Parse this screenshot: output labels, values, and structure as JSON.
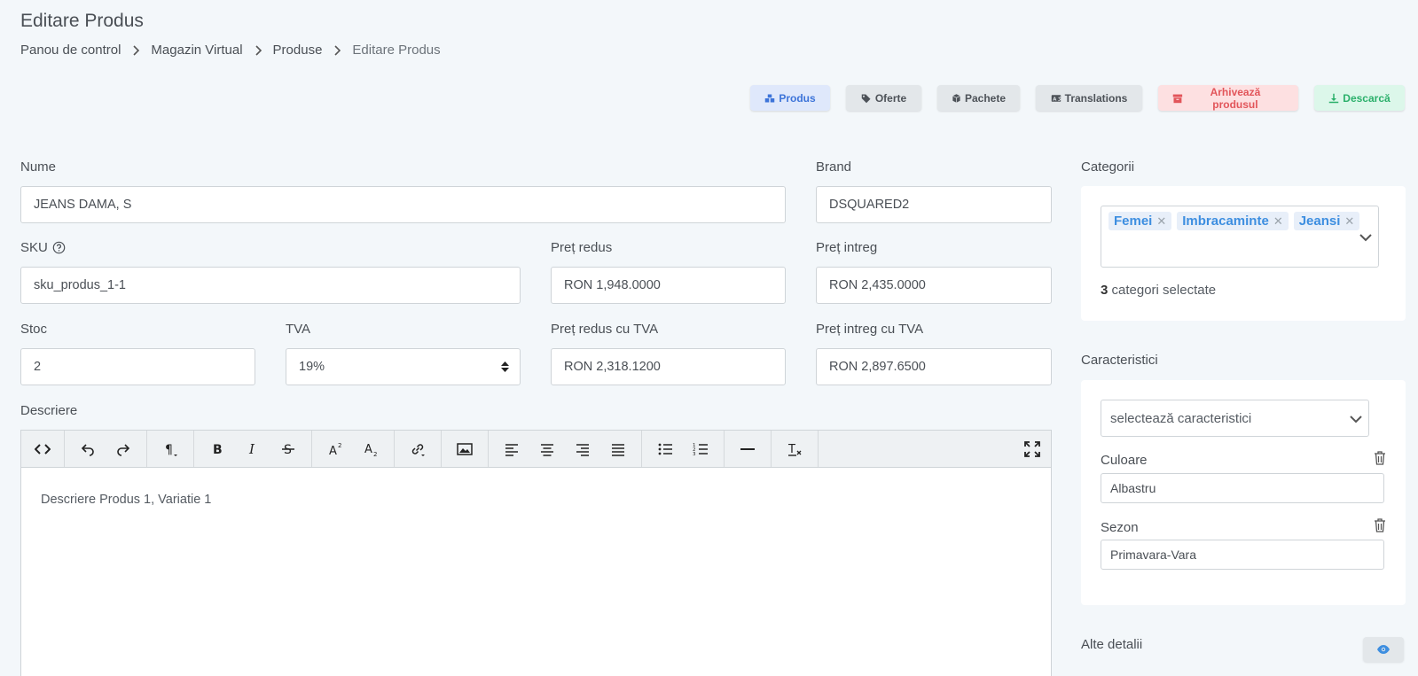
{
  "page": {
    "title": "Editare Produs"
  },
  "breadcrumb": [
    "Panou de control",
    "Magazin Virtual",
    "Produse",
    "Editare Produs"
  ],
  "actions": {
    "produs": "Produs",
    "oferte": "Oferte",
    "pachete": "Pachete",
    "translations": "Translations",
    "arhiveaza": "Arhivează produsul",
    "descarca": "Descarcă"
  },
  "form": {
    "nume": {
      "label": "Nume",
      "value": "JEANS DAMA, S"
    },
    "brand": {
      "label": "Brand",
      "value": "DSQUARED2"
    },
    "sku": {
      "label": "SKU",
      "value": "sku_produs_1-1"
    },
    "pret_redus": {
      "label": "Preț redus",
      "value": "RON 1,948.0000"
    },
    "pret_intreg": {
      "label": "Preț intreg",
      "value": "RON 2,435.0000"
    },
    "stoc": {
      "label": "Stoc",
      "value": "2"
    },
    "tva": {
      "label": "TVA",
      "value": "19%"
    },
    "pret_redus_tva": {
      "label": "Preț redus cu TVA",
      "value": "RON 2,318.1200"
    },
    "pret_intreg_tva": {
      "label": "Preț intreg cu TVA",
      "value": "RON 2,897.6500"
    },
    "descriere": {
      "label": "Descriere",
      "value": "Descriere Produs 1, Variatie 1"
    }
  },
  "sidebar": {
    "categorii": {
      "label": "Categorii",
      "tags": [
        "Femei",
        "Imbracaminte",
        "Jeansi"
      ],
      "count": "3",
      "count_text": "categori selectate"
    },
    "caracteristici": {
      "label": "Caracteristici",
      "placeholder": "selectează caracteristici",
      "items": [
        {
          "label": "Culoare",
          "value": "Albastru"
        },
        {
          "label": "Sezon",
          "value": "Primavara-Vara"
        }
      ]
    },
    "alte_detalii": {
      "label": "Alte detalii"
    }
  },
  "icons": {
    "produs": "boxes-icon",
    "oferte": "tags-icon",
    "pachete": "box-icon",
    "translations": "language-icon",
    "arhiveaza": "archive-icon",
    "descarca": "download-icon"
  },
  "colors": {
    "primary": "#3d74d9",
    "danger": "#e2555a",
    "success": "#2bb06b",
    "tag": "#3d8ee0"
  }
}
